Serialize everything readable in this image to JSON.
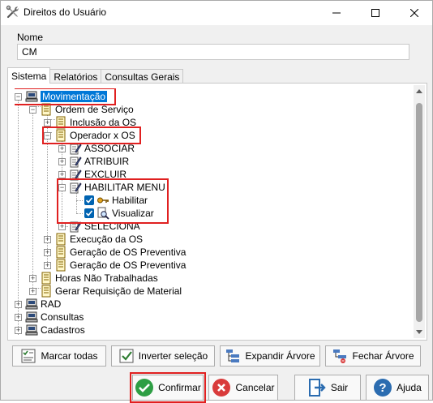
{
  "window": {
    "title": "Direitos do Usuário",
    "title_icon": "tools-icon"
  },
  "name_field": {
    "label": "Nome",
    "value": "CM"
  },
  "tabs": [
    {
      "label": "Sistema",
      "active": true
    },
    {
      "label": "Relatórios",
      "active": false
    },
    {
      "label": "Consultas Gerais",
      "active": false
    }
  ],
  "tree": {
    "movimentacao": "Movimentação",
    "ordem_servico": "Ordem de Serviço",
    "inclusao_os": "Inclusão da OS",
    "operador_os": "Operador x OS",
    "associar": "ASSOCIAR",
    "atribuir": "ATRIBUIR",
    "excluir": "EXCLUIR",
    "habilitar_menu": "HABILITAR MENU",
    "habilitar": "Habilitar",
    "visualizar": "Visualizar",
    "seleciona": "SELECIONA",
    "execucao_os": "Execução da OS",
    "geracao_os_1": "Geração de OS Preventiva",
    "geracao_os_2": "Geração de OS Preventiva",
    "horas_nao_trab": "Horas Não Trabalhadas",
    "gerar_requisicao": "Gerar Requisição de Material",
    "rad": "RAD",
    "consultas": "Consultas",
    "cadastros": "Cadastros"
  },
  "tree_buttons": {
    "marcar_todas": "Marcar todas",
    "inverter_selecao": "Inverter seleção",
    "expandir_arvore": "Expandir Árvore",
    "fechar_arvore": "Fechar Árvore"
  },
  "footer_buttons": {
    "confirmar": "Confirmar",
    "cancelar": "Cancelar",
    "sair": "Sair",
    "ajuda": "Ajuda"
  },
  "colors": {
    "selection": "#0078d7",
    "highlight_box": "#e02020",
    "checkbox": "#0063b1",
    "confirm_green": "#2e9e44",
    "cancel_red": "#d93b3b",
    "exit_blue": "#2b6cb0",
    "help_blue": "#2b6cb0"
  }
}
